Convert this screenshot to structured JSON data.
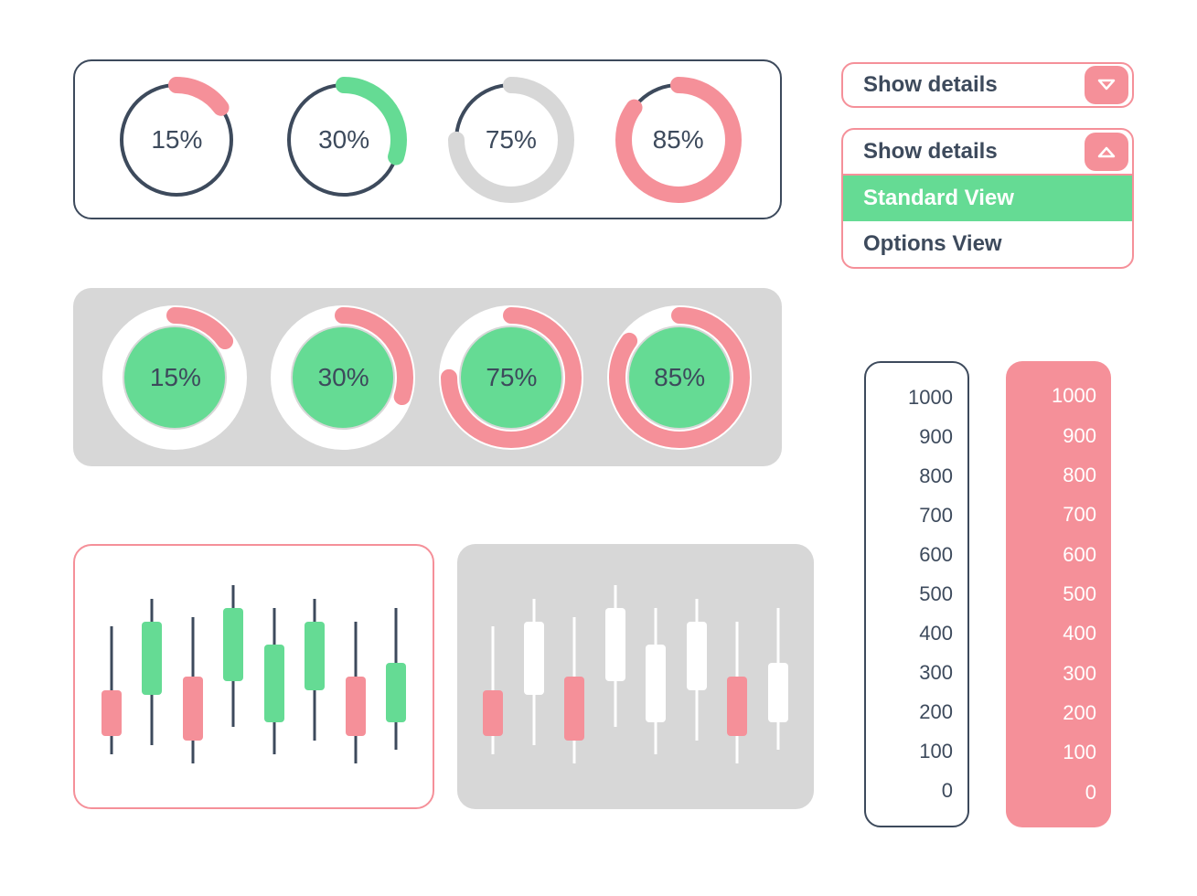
{
  "colors": {
    "dark": "#3d4a5c",
    "pink": "#f59099",
    "green": "#65db94",
    "grey": "#d7d7d7",
    "white": "#ffffff"
  },
  "donuts_a": [
    {
      "value": 15,
      "label": "15%",
      "ring": "#3d4a5c",
      "arc": "#f59099"
    },
    {
      "value": 30,
      "label": "30%",
      "ring": "#3d4a5c",
      "arc": "#65db94"
    },
    {
      "value": 75,
      "label": "75%",
      "ring": "#3d4a5c",
      "arc": "#d7d7d7"
    },
    {
      "value": 85,
      "label": "85%",
      "ring": "#3d4a5c",
      "arc": "#f59099"
    }
  ],
  "donuts_b": [
    {
      "value": 15,
      "label": "15%"
    },
    {
      "value": 30,
      "label": "30%"
    },
    {
      "value": 75,
      "label": "75%"
    },
    {
      "value": 85,
      "label": "85%"
    }
  ],
  "candles_1": [
    {
      "wickTop": 60,
      "wickBottom": 200,
      "bodyTop": 130,
      "bodyBottom": 180,
      "color": "#f59099",
      "wickColor": "#3d4a5c"
    },
    {
      "wickTop": 30,
      "wickBottom": 190,
      "bodyTop": 55,
      "bodyBottom": 135,
      "color": "#65db94",
      "wickColor": "#3d4a5c"
    },
    {
      "wickTop": 50,
      "wickBottom": 210,
      "bodyTop": 115,
      "bodyBottom": 185,
      "color": "#f59099",
      "wickColor": "#3d4a5c"
    },
    {
      "wickTop": 15,
      "wickBottom": 170,
      "bodyTop": 40,
      "bodyBottom": 120,
      "color": "#65db94",
      "wickColor": "#3d4a5c"
    },
    {
      "wickTop": 40,
      "wickBottom": 200,
      "bodyTop": 80,
      "bodyBottom": 165,
      "color": "#65db94",
      "wickColor": "#3d4a5c"
    },
    {
      "wickTop": 30,
      "wickBottom": 185,
      "bodyTop": 55,
      "bodyBottom": 130,
      "color": "#65db94",
      "wickColor": "#3d4a5c"
    },
    {
      "wickTop": 55,
      "wickBottom": 210,
      "bodyTop": 115,
      "bodyBottom": 180,
      "color": "#f59099",
      "wickColor": "#3d4a5c"
    },
    {
      "wickTop": 40,
      "wickBottom": 195,
      "bodyTop": 100,
      "bodyBottom": 165,
      "color": "#65db94",
      "wickColor": "#3d4a5c"
    }
  ],
  "candles_2": [
    {
      "wickTop": 60,
      "wickBottom": 200,
      "bodyTop": 130,
      "bodyBottom": 180,
      "color": "#f59099",
      "wickColor": "#ffffff"
    },
    {
      "wickTop": 30,
      "wickBottom": 190,
      "bodyTop": 55,
      "bodyBottom": 135,
      "color": "#ffffff",
      "wickColor": "#ffffff"
    },
    {
      "wickTop": 50,
      "wickBottom": 210,
      "bodyTop": 115,
      "bodyBottom": 185,
      "color": "#f59099",
      "wickColor": "#ffffff"
    },
    {
      "wickTop": 15,
      "wickBottom": 170,
      "bodyTop": 40,
      "bodyBottom": 120,
      "color": "#ffffff",
      "wickColor": "#ffffff"
    },
    {
      "wickTop": 40,
      "wickBottom": 200,
      "bodyTop": 80,
      "bodyBottom": 165,
      "color": "#ffffff",
      "wickColor": "#ffffff"
    },
    {
      "wickTop": 30,
      "wickBottom": 185,
      "bodyTop": 55,
      "bodyBottom": 130,
      "color": "#ffffff",
      "wickColor": "#ffffff"
    },
    {
      "wickTop": 55,
      "wickBottom": 210,
      "bodyTop": 115,
      "bodyBottom": 180,
      "color": "#f59099",
      "wickColor": "#ffffff"
    },
    {
      "wickTop": 40,
      "wickBottom": 195,
      "bodyTop": 100,
      "bodyBottom": 165,
      "color": "#ffffff",
      "wickColor": "#ffffff"
    }
  ],
  "dropdown_closed": {
    "label": "Show details"
  },
  "dropdown_open": {
    "label": "Show details",
    "options": [
      {
        "label": "Standard View",
        "active": true
      },
      {
        "label": "Options View",
        "active": false
      }
    ]
  },
  "scale_values": [
    "1000",
    "900",
    "800",
    "700",
    "600",
    "500",
    "400",
    "300",
    "200",
    "100",
    "0"
  ]
}
